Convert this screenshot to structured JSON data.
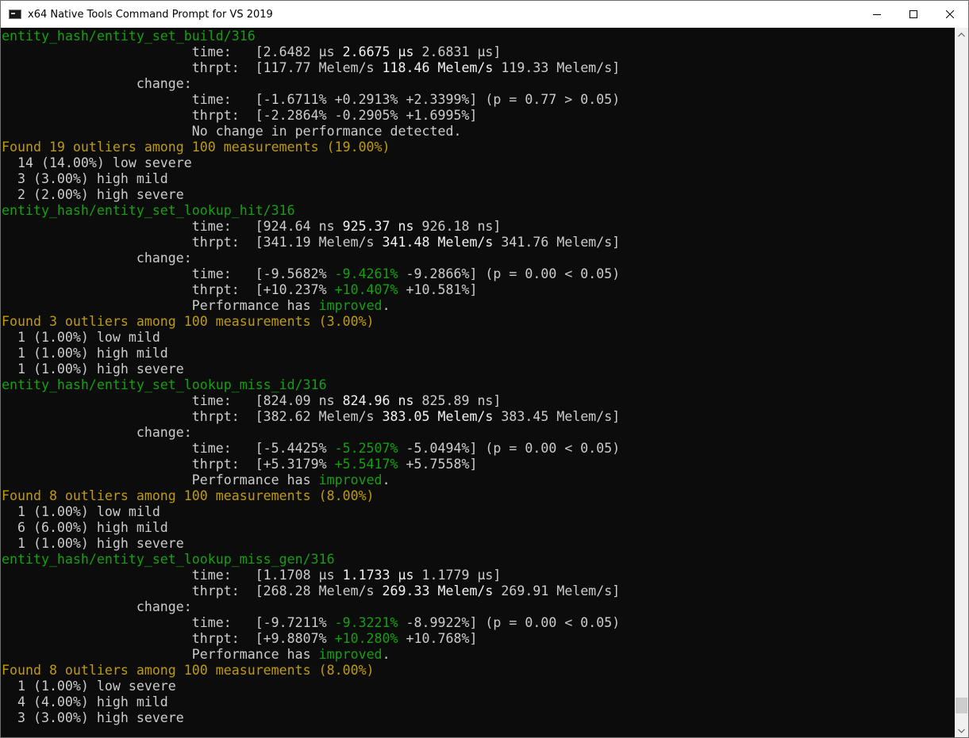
{
  "window": {
    "title": "x64 Native Tools Command Prompt for VS 2019",
    "icons": {
      "app": "console-app-icon",
      "minimize": "minimize-icon",
      "maximize": "maximize-icon",
      "close": "close-icon"
    }
  },
  "colors": {
    "background": "#0c0c0c",
    "default_text": "#cccccc",
    "bright_text": "#f2f2f2",
    "green": "#13a10e",
    "yellow": "#c19c00"
  },
  "console": {
    "lines": [
      [
        {
          "t": "entity_hash/entity_set_build/316",
          "c": "g"
        }
      ],
      [
        {
          "t": "                        time:   [2.6482 µs "
        },
        {
          "t": "2.6675 µs",
          "c": "b"
        },
        {
          "t": " 2.6831 µs]"
        }
      ],
      [
        {
          "t": "                        thrpt:  [117.77 Melem/s "
        },
        {
          "t": "118.46 Melem/s",
          "c": "b"
        },
        {
          "t": " 119.33 Melem/s]"
        }
      ],
      [
        {
          "t": "                 change:"
        }
      ],
      [
        {
          "t": "                        time:   [-1.6711% +0.2913% +2.3399%] (p = 0.77 > 0.05)"
        }
      ],
      [
        {
          "t": "                        thrpt:  [-2.2864% -0.2905% +1.6995%]"
        }
      ],
      [
        {
          "t": "                        No change in performance detected."
        }
      ],
      [
        {
          "t": "Found 19 outliers among 100 measurements (19.00%)",
          "c": "y"
        }
      ],
      [
        {
          "t": "  14 (14.00%) low severe"
        }
      ],
      [
        {
          "t": "  3 (3.00%) high mild"
        }
      ],
      [
        {
          "t": "  2 (2.00%) high severe"
        }
      ],
      [
        {
          "t": "entity_hash/entity_set_lookup_hit/316",
          "c": "g"
        }
      ],
      [
        {
          "t": "                        time:   [924.64 ns "
        },
        {
          "t": "925.37 ns",
          "c": "b"
        },
        {
          "t": " 926.18 ns]"
        }
      ],
      [
        {
          "t": "                        thrpt:  [341.19 Melem/s "
        },
        {
          "t": "341.48 Melem/s",
          "c": "b"
        },
        {
          "t": " 341.76 Melem/s]"
        }
      ],
      [
        {
          "t": "                 change:"
        }
      ],
      [
        {
          "t": "                        time:   [-9.5682% "
        },
        {
          "t": "-9.4261%",
          "c": "g"
        },
        {
          "t": " -9.2866%] (p = 0.00 < 0.05)"
        }
      ],
      [
        {
          "t": "                        thrpt:  [+10.237% "
        },
        {
          "t": "+10.407%",
          "c": "g"
        },
        {
          "t": " +10.581%]"
        }
      ],
      [
        {
          "t": "                        Performance has "
        },
        {
          "t": "improved",
          "c": "g"
        },
        {
          "t": "."
        }
      ],
      [
        {
          "t": "Found 3 outliers among 100 measurements (3.00%)",
          "c": "y"
        }
      ],
      [
        {
          "t": "  1 (1.00%) low mild"
        }
      ],
      [
        {
          "t": "  1 (1.00%) high mild"
        }
      ],
      [
        {
          "t": "  1 (1.00%) high severe"
        }
      ],
      [
        {
          "t": "entity_hash/entity_set_lookup_miss_id/316",
          "c": "g"
        }
      ],
      [
        {
          "t": "                        time:   [824.09 ns "
        },
        {
          "t": "824.96 ns",
          "c": "b"
        },
        {
          "t": " 825.89 ns]"
        }
      ],
      [
        {
          "t": "                        thrpt:  [382.62 Melem/s "
        },
        {
          "t": "383.05 Melem/s",
          "c": "b"
        },
        {
          "t": " 383.45 Melem/s]"
        }
      ],
      [
        {
          "t": "                 change:"
        }
      ],
      [
        {
          "t": "                        time:   [-5.4425% "
        },
        {
          "t": "-5.2507%",
          "c": "g"
        },
        {
          "t": " -5.0494%] (p = 0.00 < 0.05)"
        }
      ],
      [
        {
          "t": "                        thrpt:  [+5.3179% "
        },
        {
          "t": "+5.5417%",
          "c": "g"
        },
        {
          "t": " +5.7558%]"
        }
      ],
      [
        {
          "t": "                        Performance has "
        },
        {
          "t": "improved",
          "c": "g"
        },
        {
          "t": "."
        }
      ],
      [
        {
          "t": "Found 8 outliers among 100 measurements (8.00%)",
          "c": "y"
        }
      ],
      [
        {
          "t": "  1 (1.00%) low mild"
        }
      ],
      [
        {
          "t": "  6 (6.00%) high mild"
        }
      ],
      [
        {
          "t": "  1 (1.00%) high severe"
        }
      ],
      [
        {
          "t": "entity_hash/entity_set_lookup_miss_gen/316",
          "c": "g"
        }
      ],
      [
        {
          "t": "                        time:   [1.1708 µs "
        },
        {
          "t": "1.1733 µs",
          "c": "b"
        },
        {
          "t": " 1.1779 µs]"
        }
      ],
      [
        {
          "t": "                        thrpt:  [268.28 Melem/s "
        },
        {
          "t": "269.33 Melem/s",
          "c": "b"
        },
        {
          "t": " 269.91 Melem/s]"
        }
      ],
      [
        {
          "t": "                 change:"
        }
      ],
      [
        {
          "t": "                        time:   [-9.7211% "
        },
        {
          "t": "-9.3221%",
          "c": "g"
        },
        {
          "t": " -8.9922%] (p = 0.00 < 0.05)"
        }
      ],
      [
        {
          "t": "                        thrpt:  [+9.8807% "
        },
        {
          "t": "+10.280%",
          "c": "g"
        },
        {
          "t": " +10.768%]"
        }
      ],
      [
        {
          "t": "                        Performance has "
        },
        {
          "t": "improved",
          "c": "g"
        },
        {
          "t": "."
        }
      ],
      [
        {
          "t": "Found 8 outliers among 100 measurements (8.00%)",
          "c": "y"
        }
      ],
      [
        {
          "t": "  1 (1.00%) low severe"
        }
      ],
      [
        {
          "t": "  4 (4.00%) high mild"
        }
      ],
      [
        {
          "t": "  3 (3.00%) high severe"
        }
      ]
    ]
  }
}
